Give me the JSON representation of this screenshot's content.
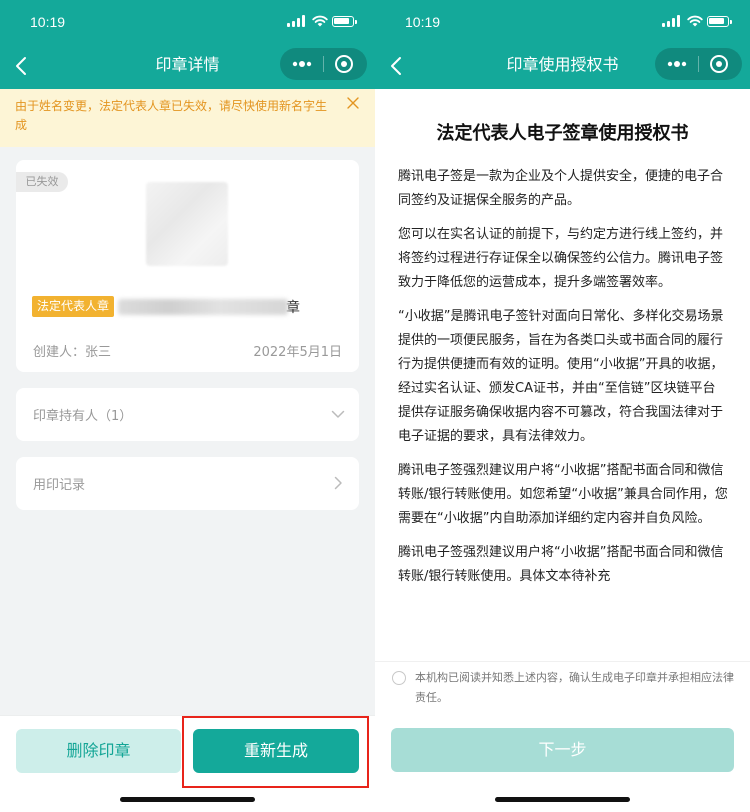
{
  "left": {
    "status": {
      "time": "10:19"
    },
    "nav": {
      "title": "印章详情"
    },
    "notice": {
      "text": "由于姓名变更，法定代表人章已失效，请尽快使用新名字生成"
    },
    "seal": {
      "status_tag": "已失效",
      "type_tag": "法定代表人章",
      "name_suffix": "章",
      "creator": "创建人：张三",
      "created_date": "2022年5月1日"
    },
    "holder": {
      "label": "印章持有人（1）"
    },
    "records": {
      "label": "用印记录"
    },
    "actions": {
      "delete": "删除印章",
      "regenerate": "重新生成"
    }
  },
  "right": {
    "status": {
      "time": "10:19"
    },
    "nav": {
      "title": "印章使用授权书"
    },
    "doc": {
      "title": "法定代表人电子签章使用授权书",
      "paragraphs": [
        "腾讯电子签是一款为企业及个人提供安全，便捷的电子合同签约及证据保全服务的产品。",
        "您可以在实名认证的前提下，与约定方进行线上签约，并将签约过程进行存证保全以确保签约公信力。腾讯电子签致力于降低您的运营成本，提升多端签署效率。",
        "“小收据”是腾讯电子签针对面向日常化、多样化交易场景提供的一项便民服务，旨在为各类口头或书面合同的履行行为提供便捷而有效的证明。使用“小收据”开具的收据，经过实名认证、颁发CA证书，并由“至信链”区块链平台提供存证服务确保收据内容不可篡改，符合我国法律对于电子证据的要求，具有法律效力。",
        "腾讯电子签强烈建议用户将“小收据”搭配书面合同和微信转账/银行转账使用。如您希望“小收据”兼具合同作用，您需要在“小收据”内自助添加详细约定内容并自负风险。",
        "腾讯电子签强烈建议用户将“小收据”搭配书面合同和微信转账/银行转账使用。具体文本待补充"
      ]
    },
    "agree": {
      "text": "本机构已阅读并知悉上述内容，确认生成电子印章并承担相应法律责任。"
    },
    "actions": {
      "next": "下一步"
    }
  },
  "colors": {
    "brand": "#14a99a",
    "warning_bg": "#fdf5d6",
    "warning_text": "#e39521",
    "tag_orange": "#f2b230",
    "highlight_red": "#e8241a"
  }
}
